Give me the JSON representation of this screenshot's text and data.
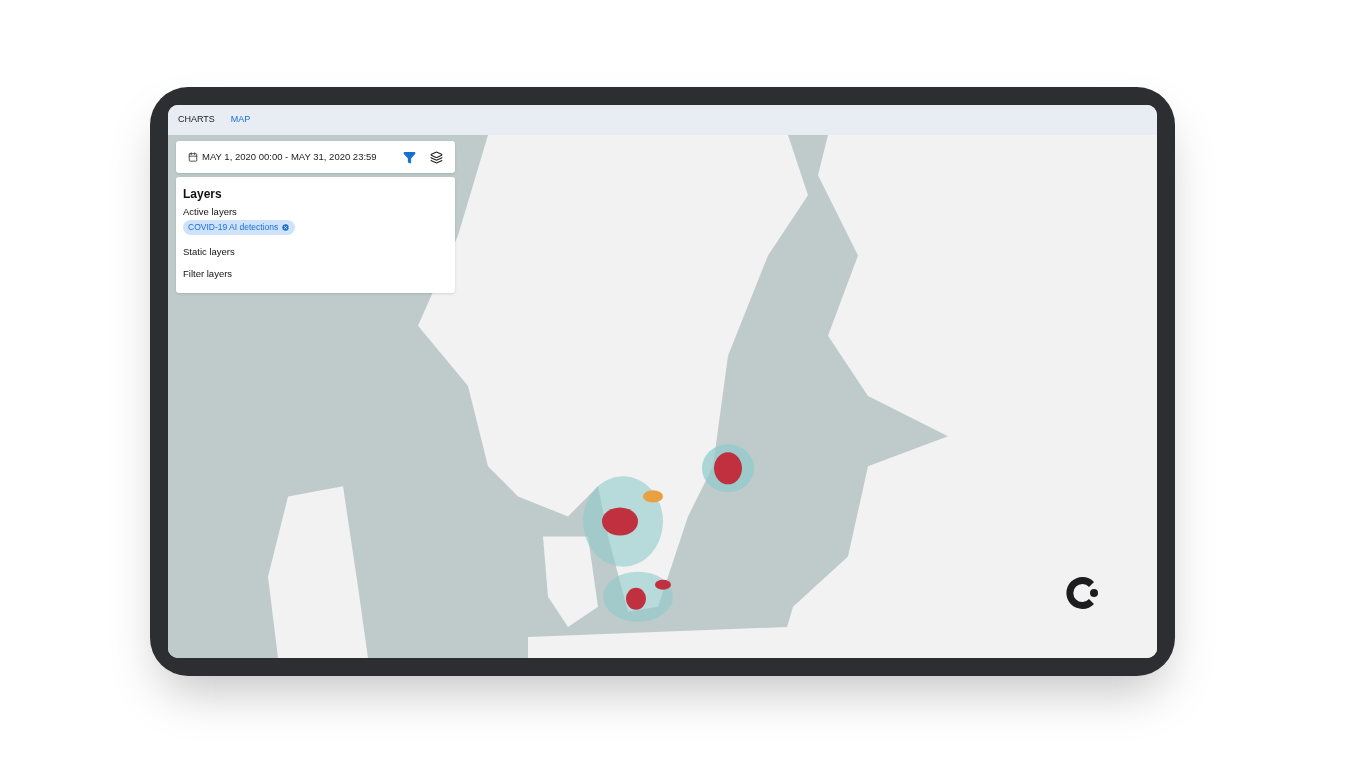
{
  "tabs": [
    {
      "label": "CHARTS",
      "selected": false
    },
    {
      "label": "MAP",
      "selected": true
    }
  ],
  "date_range": "MAY 1, 2020 00:00 - MAY 31, 2020 23:59",
  "layers_panel": {
    "title": "Layers",
    "active_label": "Active layers",
    "active_layers": [
      {
        "label": "COVID-19 AI detections"
      }
    ],
    "sections": [
      "Static layers",
      "Filter layers"
    ]
  }
}
